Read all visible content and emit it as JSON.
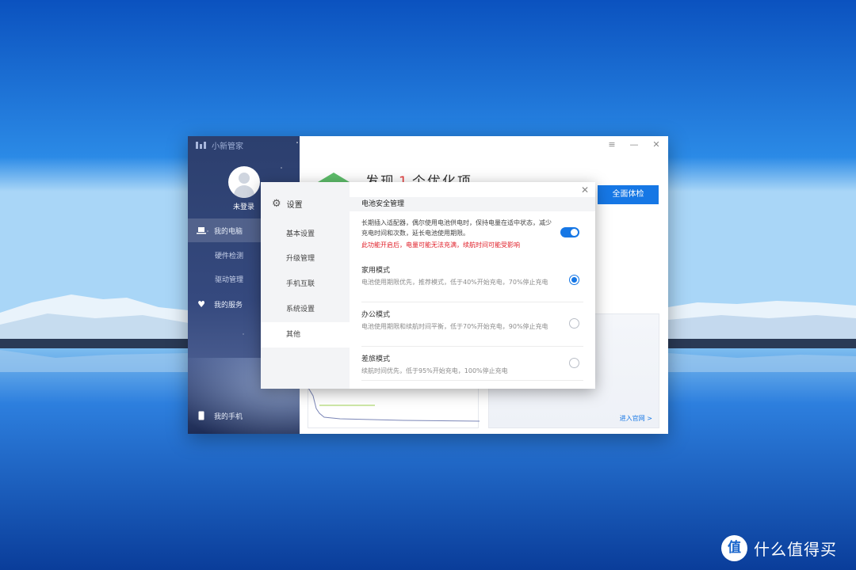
{
  "app": {
    "title": "小新管家",
    "username": "未登录",
    "nav": [
      {
        "label": "我的电脑",
        "icon": "laptop-icon"
      },
      {
        "label": "硬件检测"
      },
      {
        "label": "驱动管理"
      },
      {
        "label": "我的服务",
        "icon": "heart-icon"
      },
      {
        "label": "我的手机",
        "icon": "phone-icon"
      }
    ],
    "window_controls": [
      "≡",
      "—",
      "✕"
    ]
  },
  "main": {
    "headline_prefix": "发现",
    "headline_count": "1",
    "headline_suffix": "个优化项",
    "scan_button": "全面体检",
    "official_link": "进入官网 >"
  },
  "dialog": {
    "title": "设置",
    "close": "✕",
    "nav": [
      "基本设置",
      "升级管理",
      "手机互联",
      "系统设置",
      "其他"
    ],
    "active_nav": "其他",
    "section_title": "电池安全管理",
    "description": "长期插入适配器，偶尔使用电池供电时，保持电量在适中状态，减少充电时间和次数，延长电池使用期限。",
    "warning": "此功能开启后，电量可能无法充满，续航时间可能受影响",
    "toggle_on": true,
    "modes": [
      {
        "title": "家用模式",
        "desc": "电池使用期限优先，推荐模式，低于40%开始充电，70%停止充电",
        "selected": true
      },
      {
        "title": "办公模式",
        "desc": "电池使用期限和续航时间平衡，低于70%开始充电，90%停止充电",
        "selected": false
      },
      {
        "title": "差旅模式",
        "desc": "续航时间优先，低于95%开始充电，100%停止充电",
        "selected": false
      }
    ]
  },
  "watermark": {
    "text": "什么值得买",
    "logo_glyph": "值"
  },
  "colors": {
    "accent": "#1677e5",
    "warning": "#e0202a",
    "sidebar": "#2c3f6e"
  }
}
